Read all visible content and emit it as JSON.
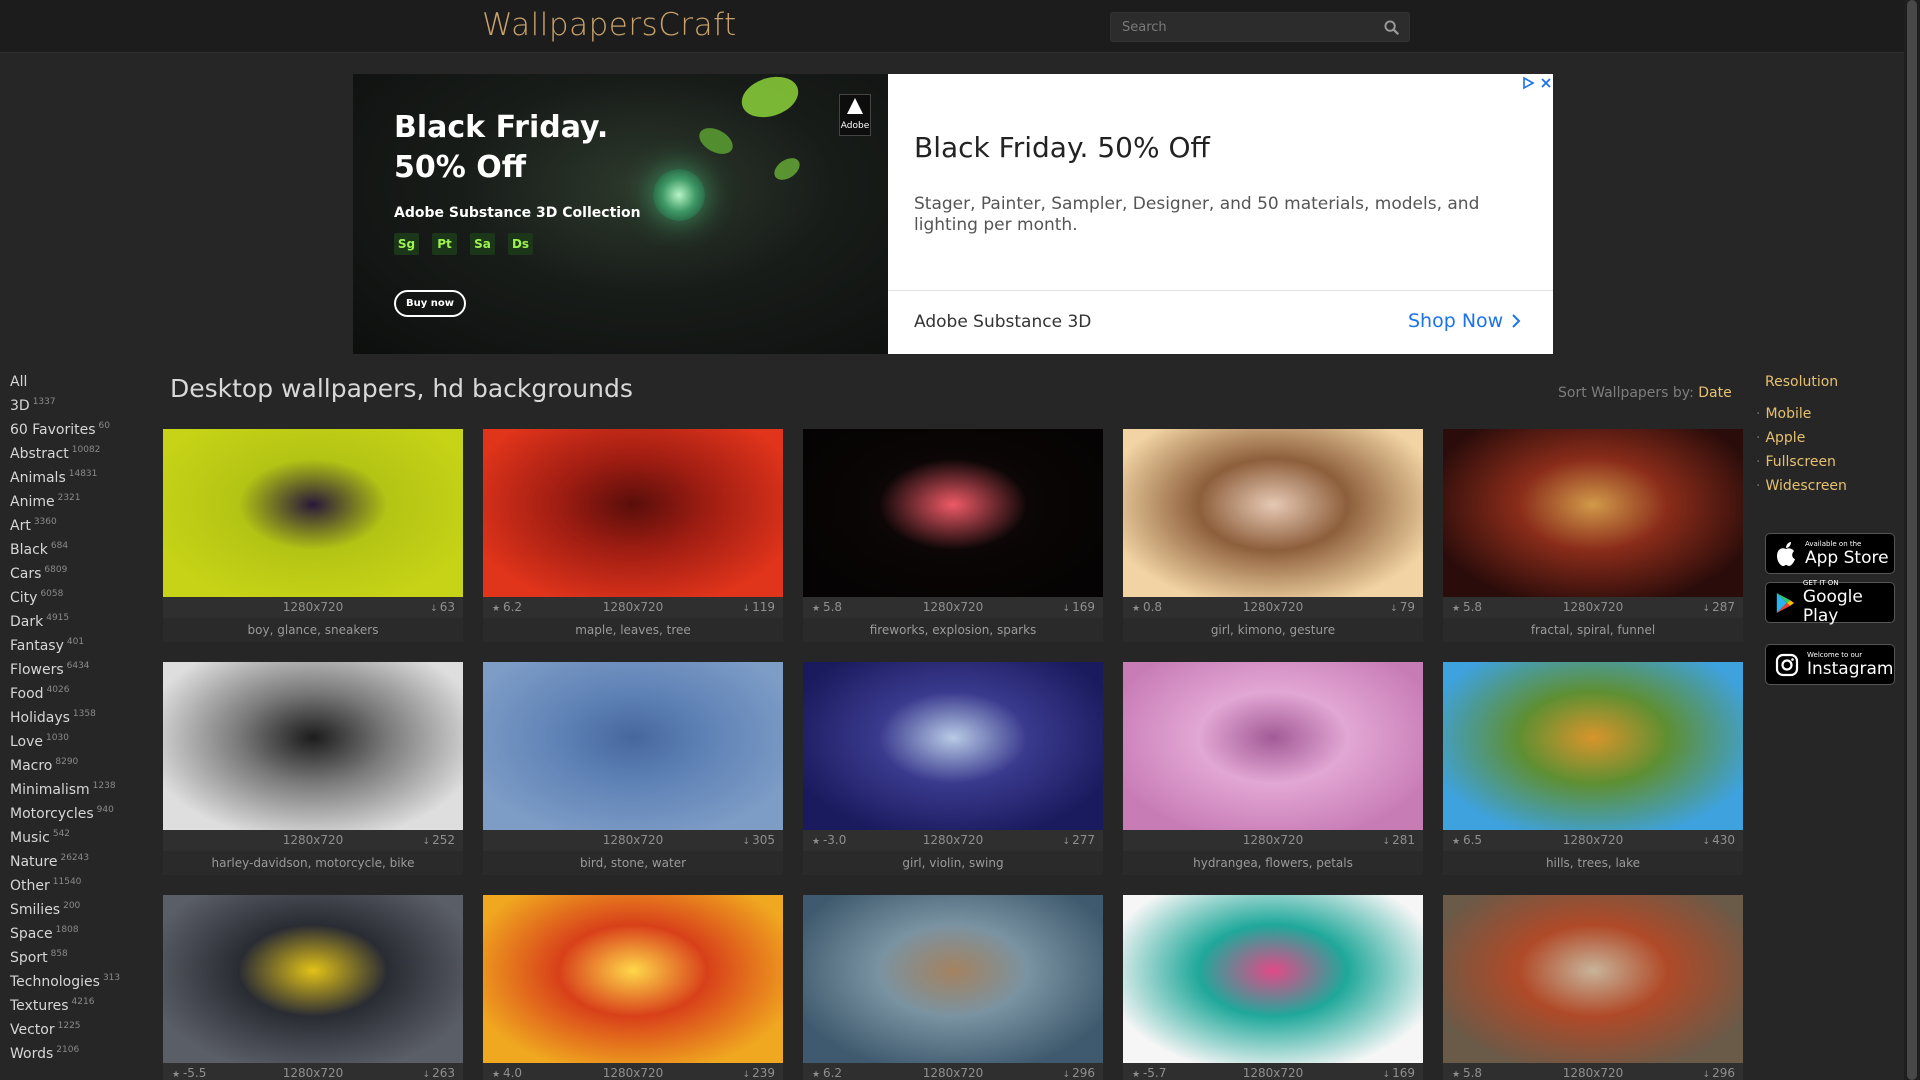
{
  "header": {
    "logo": "WallpapersCraft",
    "search_placeholder": "Search"
  },
  "ad": {
    "headline": "Black Friday. 50% Off",
    "subline": "Adobe Substance 3D Collection",
    "chips": [
      "Sg",
      "Pt",
      "Sa",
      "Ds"
    ],
    "buy_label": "Buy now",
    "badge": "Adobe",
    "title": "Black Friday. 50% Off",
    "description": "Stager, Painter, Sampler, Designer, and 50 materials, models, and lighting per month.",
    "brand": "Adobe Substance 3D",
    "cta": "Shop Now"
  },
  "categories": [
    {
      "name": "All",
      "count": ""
    },
    {
      "name": "3D",
      "count": "1337"
    },
    {
      "name": "60 Favorites",
      "count": "60"
    },
    {
      "name": "Abstract",
      "count": "10082"
    },
    {
      "name": "Animals",
      "count": "14831"
    },
    {
      "name": "Anime",
      "count": "2321"
    },
    {
      "name": "Art",
      "count": "3360"
    },
    {
      "name": "Black",
      "count": "684"
    },
    {
      "name": "Cars",
      "count": "6809"
    },
    {
      "name": "City",
      "count": "6058"
    },
    {
      "name": "Dark",
      "count": "4915"
    },
    {
      "name": "Fantasy",
      "count": "401"
    },
    {
      "name": "Flowers",
      "count": "6434"
    },
    {
      "name": "Food",
      "count": "4026"
    },
    {
      "name": "Holidays",
      "count": "1358"
    },
    {
      "name": "Love",
      "count": "1030"
    },
    {
      "name": "Macro",
      "count": "8290"
    },
    {
      "name": "Minimalism",
      "count": "1238"
    },
    {
      "name": "Motorcycles",
      "count": "940"
    },
    {
      "name": "Music",
      "count": "542"
    },
    {
      "name": "Nature",
      "count": "26243"
    },
    {
      "name": "Other",
      "count": "11540"
    },
    {
      "name": "Smilies",
      "count": "200"
    },
    {
      "name": "Space",
      "count": "1808"
    },
    {
      "name": "Sport",
      "count": "858"
    },
    {
      "name": "Technologies",
      "count": "313"
    },
    {
      "name": "Textures",
      "count": "4216"
    },
    {
      "name": "Vector",
      "count": "1225"
    },
    {
      "name": "Words",
      "count": "2106"
    }
  ],
  "main": {
    "title": "Desktop wallpapers, hd backgrounds",
    "sort_label": "Sort Wallpapers by:",
    "sort_value": "Date"
  },
  "wallpapers": [
    {
      "rating": "",
      "resolution": "1280x720",
      "downloads": "63",
      "tags": "boy, glance, sneakers",
      "palette": [
        "#c6d316",
        "#b4c414",
        "#2a1838"
      ]
    },
    {
      "rating": "6.2",
      "resolution": "1280x720",
      "downloads": "119",
      "tags": "maple, leaves, tree",
      "palette": [
        "#e0341b",
        "#9f1d12",
        "#5a0e0a"
      ]
    },
    {
      "rating": "5.8",
      "resolution": "1280x720",
      "downloads": "169",
      "tags": "fireworks, explosion, sparks",
      "palette": [
        "#050303",
        "#0c0606",
        "#ee5a66"
      ]
    },
    {
      "rating": "0.8",
      "resolution": "1280x720",
      "downloads": "79",
      "tags": "girl, kimono, gesture",
      "palette": [
        "#f2d4a4",
        "#8d5f3c",
        "#e7c9b4"
      ]
    },
    {
      "rating": "5.8",
      "resolution": "1280x720",
      "downloads": "287",
      "tags": "fractal, spiral, funnel",
      "palette": [
        "#2a0c0a",
        "#8a2c1a",
        "#d29a4a"
      ]
    },
    {
      "rating": "",
      "resolution": "1280x720",
      "downloads": "252",
      "tags": "harley-davidson, motorcycle, bike",
      "palette": [
        "#dedede",
        "#7a7a7a",
        "#1c1c1c"
      ]
    },
    {
      "rating": "",
      "resolution": "1280x720",
      "downloads": "305",
      "tags": "bird, stone, water",
      "palette": [
        "#7d9cc6",
        "#5f82b6",
        "#45679e"
      ]
    },
    {
      "rating": "-3.0",
      "resolution": "1280x720",
      "downloads": "277",
      "tags": "girl, violin, swing",
      "palette": [
        "#1a1a5e",
        "#3a3a8e",
        "#b8cbe6"
      ]
    },
    {
      "rating": "",
      "resolution": "1280x720",
      "downloads": "281",
      "tags": "hydrangea, flowers, petals",
      "palette": [
        "#c87cb6",
        "#e2a7d4",
        "#a25a96"
      ]
    },
    {
      "rating": "6.5",
      "resolution": "1280x720",
      "downloads": "430",
      "tags": "hills, trees, lake",
      "palette": [
        "#3ea2df",
        "#5f8f32",
        "#d8952c"
      ]
    },
    {
      "rating": "-5.5",
      "resolution": "1280x720",
      "downloads": "263",
      "tags": "",
      "palette": [
        "#5a5e66",
        "#2a2c34",
        "#e2c218"
      ]
    },
    {
      "rating": "4.0",
      "resolution": "1280x720",
      "downloads": "239",
      "tags": "",
      "palette": [
        "#f0a820",
        "#d8401a",
        "#ffd84a"
      ]
    },
    {
      "rating": "6.2",
      "resolution": "1280x720",
      "downloads": "296",
      "tags": "",
      "palette": [
        "#3f5a6e",
        "#7a93a2",
        "#a48260"
      ]
    },
    {
      "rating": "-5.7",
      "resolution": "1280x720",
      "downloads": "169",
      "tags": "",
      "palette": [
        "#f6f6f6",
        "#1fa89a",
        "#e24a88"
      ]
    },
    {
      "rating": "5.8",
      "resolution": "1280x720",
      "downloads": "296",
      "tags": "",
      "palette": [
        "#6a5a48",
        "#b04a28",
        "#c8b49a"
      ]
    }
  ],
  "resolution_panel": {
    "title": "Resolution",
    "links": [
      "Mobile",
      "Apple",
      "Fullscreen",
      "Widescreen"
    ]
  },
  "stores": [
    {
      "small": "Available on the",
      "big": "App Store",
      "icon": "apple-icon"
    },
    {
      "small": "GET IT ON",
      "big": "Google Play",
      "icon": "google-play-icon"
    },
    {
      "small": "Welcome to our",
      "big": "Instagram",
      "icon": "instagram-icon"
    }
  ],
  "colors": {
    "accent": "#e6c070",
    "background": "#262626",
    "header": "#1c1c1c",
    "ad_cta": "#1a73e8"
  }
}
